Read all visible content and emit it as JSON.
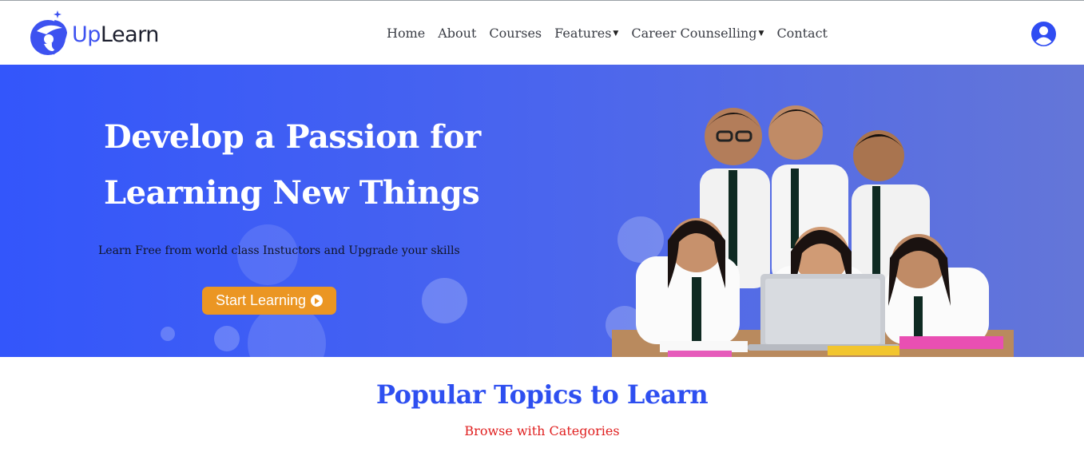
{
  "brand": {
    "name_part1": "Up",
    "name_part2": "Learn",
    "color": "#3d52f0",
    "logo_icon": "uplearn-logo-icon"
  },
  "nav": {
    "items": [
      {
        "label": "Home",
        "dropdown": false
      },
      {
        "label": "About",
        "dropdown": false
      },
      {
        "label": "Courses",
        "dropdown": false
      },
      {
        "label": "Features",
        "dropdown": true
      },
      {
        "label": "Career Counselling",
        "dropdown": true
      },
      {
        "label": "Contact",
        "dropdown": false
      }
    ],
    "user_icon": "user-account-icon"
  },
  "hero": {
    "title_line1": "Develop a Passion for",
    "title_line2": "Learning New Things",
    "subtitle": "Learn Free from world class Instuctors and Upgrade your skills",
    "cta_label": "Start Learning",
    "cta_icon": "play-circle-icon",
    "cta_color": "#eb9623",
    "bg_color_start": "#3356fb",
    "bg_color_end": "#6476d8",
    "image": "students-with-laptop-image"
  },
  "popular": {
    "title": "Popular Topics to Learn",
    "subtitle": "Browse with Categories",
    "title_color": "#2e4ff0",
    "subtitle_color": "#e02020"
  }
}
